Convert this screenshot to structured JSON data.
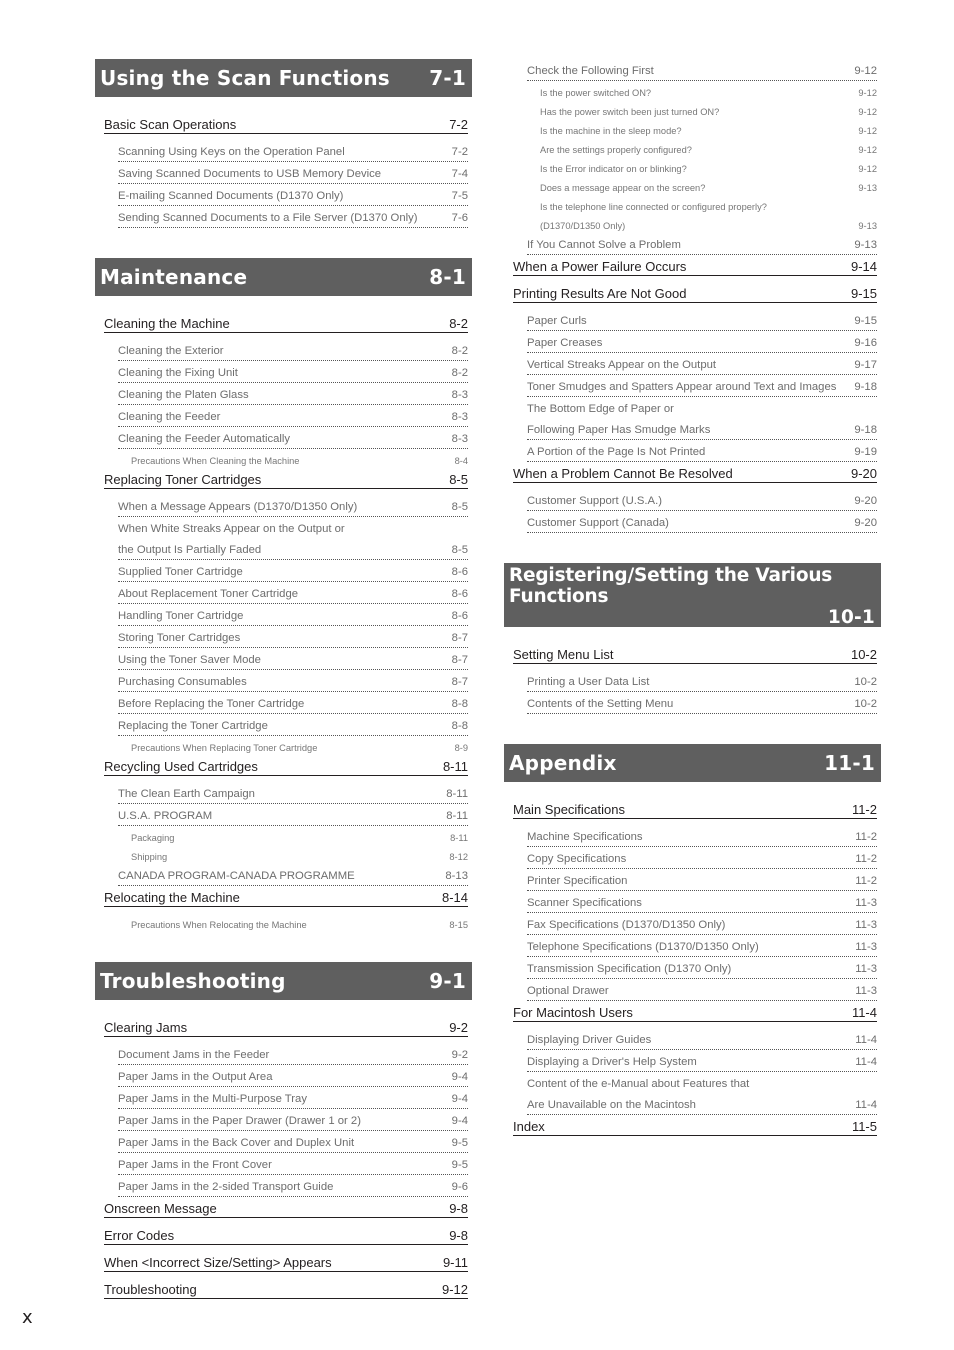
{
  "page_marker": "x",
  "left_column": [
    {
      "title": "Using the Scan Functions",
      "page": "7-1",
      "entries": [
        {
          "level": 1,
          "text": "Basic Scan Operations",
          "page": "7-2"
        },
        {
          "level": 2,
          "text": "Scanning Using Keys on the Operation Panel",
          "page": "7-2"
        },
        {
          "level": 2,
          "text": "Saving Scanned Documents to USB Memory Device",
          "page": "7-4"
        },
        {
          "level": 2,
          "text": "E-mailing Scanned Documents (D1370 Only)",
          "page": "7-5"
        },
        {
          "level": 2,
          "text": "Sending Scanned Documents to a File Server (D1370 Only)",
          "page": "7-6"
        }
      ]
    },
    {
      "title": "Maintenance",
      "page": "8-1",
      "entries": [
        {
          "level": 1,
          "text": "Cleaning the Machine",
          "page": "8-2"
        },
        {
          "level": 2,
          "text": "Cleaning the Exterior",
          "page": "8-2"
        },
        {
          "level": 2,
          "text": "Cleaning the Fixing Unit",
          "page": "8-2"
        },
        {
          "level": 2,
          "text": "Cleaning the Platen Glass",
          "page": "8-3"
        },
        {
          "level": 2,
          "text": "Cleaning the Feeder",
          "page": "8-3"
        },
        {
          "level": 2,
          "text": "Cleaning the Feeder Automatically",
          "page": "8-3"
        },
        {
          "level": 3,
          "text": "Precautions When Cleaning the Machine",
          "page": "8-4"
        },
        {
          "level": 1,
          "text": "Replacing Toner Cartridges",
          "page": "8-5"
        },
        {
          "level": 2,
          "text": "When a Message Appears (D1370/D1350 Only)",
          "page": "8-5"
        },
        {
          "level": 2,
          "text": "When White Streaks Appear on the Output or",
          "page": "",
          "continued": true
        },
        {
          "level": 2,
          "text": "the Output Is Partially Faded",
          "page": "8-5"
        },
        {
          "level": 2,
          "text": "Supplied Toner Cartridge",
          "page": "8-6"
        },
        {
          "level": 2,
          "text": "About Replacement Toner Cartridge",
          "page": "8-6"
        },
        {
          "level": 2,
          "text": "Handling Toner Cartridge",
          "page": "8-6"
        },
        {
          "level": 2,
          "text": "Storing Toner Cartridges",
          "page": "8-7"
        },
        {
          "level": 2,
          "text": "Using the Toner Saver Mode",
          "page": "8-7"
        },
        {
          "level": 2,
          "text": "Purchasing Consumables",
          "page": "8-7"
        },
        {
          "level": 2,
          "text": "Before Replacing the Toner Cartridge",
          "page": "8-8"
        },
        {
          "level": 2,
          "text": "Replacing the Toner Cartridge",
          "page": "8-8"
        },
        {
          "level": 3,
          "text": "Precautions When Replacing Toner Cartridge",
          "page": "8-9"
        },
        {
          "level": 1,
          "text": "Recycling Used Cartridges",
          "page": "8-11"
        },
        {
          "level": 2,
          "text": "The Clean Earth Campaign",
          "page": "8-11"
        },
        {
          "level": 2,
          "text": "U.S.A. PROGRAM",
          "page": "8-11"
        },
        {
          "level": 3,
          "text": "Packaging",
          "page": "8-11"
        },
        {
          "level": 3,
          "text": "Shipping",
          "page": "8-12"
        },
        {
          "level": 2,
          "text": "CANADA PROGRAM-CANADA PROGRAMME",
          "page": "8-13"
        },
        {
          "level": 1,
          "text": "Relocating the Machine",
          "page": "8-14"
        },
        {
          "level": 3,
          "text": "Precautions When Relocating the Machine",
          "page": "8-15"
        }
      ]
    },
    {
      "title": "Troubleshooting",
      "page": "9-1",
      "entries": [
        {
          "level": 1,
          "text": "Clearing Jams",
          "page": "9-2"
        },
        {
          "level": 2,
          "text": "Document Jams in the Feeder",
          "page": "9-2"
        },
        {
          "level": 2,
          "text": "Paper Jams in the Output Area",
          "page": "9-4"
        },
        {
          "level": 2,
          "text": "Paper Jams in the Multi-Purpose Tray",
          "page": "9-4"
        },
        {
          "level": 2,
          "text": "Paper Jams in the Paper Drawer (Drawer 1 or 2)",
          "page": "9-4"
        },
        {
          "level": 2,
          "text": "Paper Jams in the Back Cover and Duplex Unit",
          "page": "9-5"
        },
        {
          "level": 2,
          "text": "Paper Jams in the Front Cover",
          "page": "9-5"
        },
        {
          "level": 2,
          "text": "Paper Jams in the 2-sided Transport Guide",
          "page": "9-6"
        },
        {
          "level": 1,
          "text": "Onscreen Message",
          "page": "9-8",
          "spaced": true
        },
        {
          "level": 1,
          "text": "Error Codes",
          "page": "9-8",
          "spaced": true
        },
        {
          "level": 1,
          "text": "When <Incorrect Size/Setting> Appears",
          "page": "9-11",
          "spaced": true
        },
        {
          "level": 1,
          "text": "Troubleshooting",
          "page": "9-12",
          "spaced": true
        }
      ]
    }
  ],
  "right_column": [
    {
      "title": null,
      "page": null,
      "entries": [
        {
          "level": 2,
          "text": "Check the Following First",
          "page": "9-12"
        },
        {
          "level": 3,
          "text": "Is the power switched ON?",
          "page": "9-12"
        },
        {
          "level": 3,
          "text": "Has the power switch been just turned ON?",
          "page": "9-12"
        },
        {
          "level": 3,
          "text": "Is the machine in the sleep mode?",
          "page": "9-12"
        },
        {
          "level": 3,
          "text": "Are the settings properly configured?",
          "page": "9-12"
        },
        {
          "level": 3,
          "text": "Is the Error indicator on or blinking?",
          "page": "9-12"
        },
        {
          "level": 3,
          "text": "Does a message appear on the screen?",
          "page": "9-13"
        },
        {
          "level": 3,
          "text": "Is the telephone line connected or configured properly?",
          "page": "",
          "continued": true
        },
        {
          "level": 3,
          "text": "(D1370/D1350 Only)",
          "page": "9-13"
        },
        {
          "level": 2,
          "text": "If You Cannot Solve a Problem",
          "page": "9-13"
        },
        {
          "level": 1,
          "text": "When a Power Failure Occurs",
          "page": "9-14"
        },
        {
          "level": 1,
          "text": "Printing Results Are Not Good",
          "page": "9-15",
          "spaced": true
        },
        {
          "level": 2,
          "text": "Paper Curls",
          "page": "9-15"
        },
        {
          "level": 2,
          "text": "Paper Creases",
          "page": "9-16"
        },
        {
          "level": 2,
          "text": "Vertical Streaks Appear on the Output",
          "page": "9-17"
        },
        {
          "level": 2,
          "text": "Toner Smudges and Spatters Appear around Text and Images",
          "page": "9-18"
        },
        {
          "level": 2,
          "text": "The Bottom Edge of Paper or",
          "page": "",
          "continued": true
        },
        {
          "level": 2,
          "text": "Following Paper Has Smudge Marks",
          "page": "9-18"
        },
        {
          "level": 2,
          "text": "A Portion of the Page Is Not Printed",
          "page": "9-19"
        },
        {
          "level": 1,
          "text": "When a Problem Cannot Be Resolved",
          "page": "9-20"
        },
        {
          "level": 2,
          "text": "Customer Support (U.S.A.)",
          "page": "9-20"
        },
        {
          "level": 2,
          "text": "Customer Support (Canada)",
          "page": "9-20"
        }
      ]
    },
    {
      "title": "Registering/Setting the Various Functions",
      "page": "10-1",
      "tall": true,
      "entries": [
        {
          "level": 1,
          "text": "Setting Menu List",
          "page": "10-2"
        },
        {
          "level": 2,
          "text": "Printing a User Data List",
          "page": "10-2"
        },
        {
          "level": 2,
          "text": "Contents of the Setting Menu",
          "page": "10-2"
        }
      ]
    },
    {
      "title": "Appendix",
      "page": "11-1",
      "entries": [
        {
          "level": 1,
          "text": "Main Specifications",
          "page": "11-2"
        },
        {
          "level": 2,
          "text": "Machine Specifications",
          "page": "11-2"
        },
        {
          "level": 2,
          "text": "Copy Specifications",
          "page": "11-2"
        },
        {
          "level": 2,
          "text": "Printer Specification",
          "page": "11-2"
        },
        {
          "level": 2,
          "text": "Scanner Specifications",
          "page": "11-3"
        },
        {
          "level": 2,
          "text": "Fax Specifications (D1370/D1350 Only)",
          "page": "11-3"
        },
        {
          "level": 2,
          "text": "Telephone Specifications (D1370/D1350 Only)",
          "page": "11-3"
        },
        {
          "level": 2,
          "text": "Transmission Specification (D1370 Only)",
          "page": "11-3"
        },
        {
          "level": 2,
          "text": "Optional Drawer",
          "page": "11-3"
        },
        {
          "level": 1,
          "text": "For Macintosh Users",
          "page": "11-4"
        },
        {
          "level": 2,
          "text": "Displaying Driver Guides",
          "page": "11-4"
        },
        {
          "level": 2,
          "text": "Displaying a Driver's Help System",
          "page": "11-4"
        },
        {
          "level": 2,
          "text": "Content of the e-Manual about Features that",
          "page": "",
          "continued": true
        },
        {
          "level": 2,
          "text": "Are Unavailable on the Macintosh",
          "page": "11-4"
        },
        {
          "level": 1,
          "text": "Index",
          "page": "11-5"
        }
      ]
    }
  ]
}
